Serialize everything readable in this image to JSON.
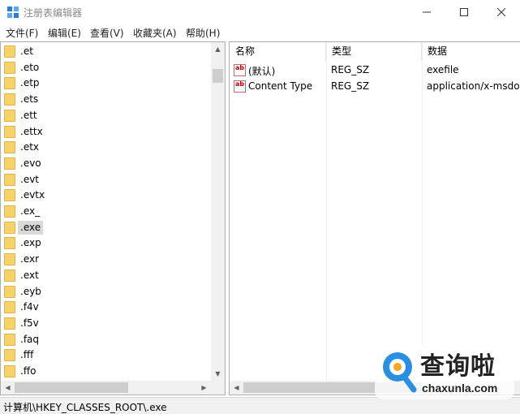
{
  "window": {
    "title": "注册表编辑器",
    "buttons": {
      "minimize": "—",
      "maximize": "☐",
      "close": "✕"
    }
  },
  "menu": [
    "文件(F)",
    "编辑(E)",
    "查看(V)",
    "收藏夹(A)",
    "帮助(H)"
  ],
  "tree": {
    "items": [
      ".et",
      ".eto",
      ".etp",
      ".ets",
      ".ett",
      ".ettx",
      ".etx",
      ".evo",
      ".evt",
      ".evtx",
      ".ex_",
      ".exe",
      ".exp",
      ".exr",
      ".ext",
      ".eyb",
      ".f4v",
      ".f5v",
      ".faq",
      ".fff",
      ".ffo"
    ],
    "selected": ".exe"
  },
  "list": {
    "columns": [
      "名称",
      "类型",
      "数据"
    ],
    "rows": [
      {
        "name": "(默认)",
        "type": "REG_SZ",
        "data": "exefile"
      },
      {
        "name": "Content Type",
        "type": "REG_SZ",
        "data": "application/x-msdownload"
      }
    ],
    "icon": "ab-string-icon"
  },
  "status": {
    "path": "计算机\\HKEY_CLASSES_ROOT\\.exe"
  },
  "watermark": {
    "brand": "查询啦",
    "url": "chaxunla.com",
    "color": "#2a8fe0"
  },
  "colors": {
    "folder": "#f7d26b",
    "selection": "#d9d9d9",
    "scrollbar": "#f0f0f0"
  }
}
